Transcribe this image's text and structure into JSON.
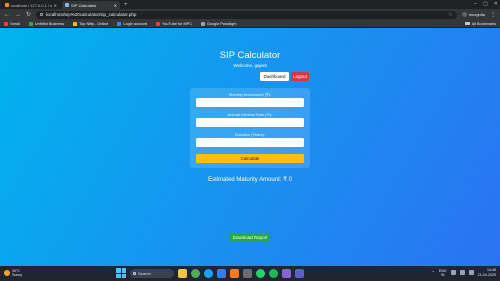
{
  "browser": {
    "tabs": [
      {
        "title": "localhost / 127.0.0.1 / sip_calcu",
        "favicon_color": "#f29900",
        "active": false
      },
      {
        "title": "SIP Calculator",
        "favicon_color": "#8ab4f8",
        "active": true
      }
    ],
    "address": "localhost/sip%20calculator/sip_calculator.php",
    "profile_label": "Incognito",
    "bookmarks": [
      {
        "label": "Gmail",
        "color": "#ea4335"
      },
      {
        "label": "Untitled Business",
        "color": "#34a853"
      },
      {
        "label": "Top Nifty - Online",
        "color": "#fbbc04"
      },
      {
        "label": "Login account",
        "color": "#4285f4"
      },
      {
        "label": "YouTube for MPC",
        "color": "#ea4335"
      },
      {
        "label": "Google Paradigm",
        "color": "#9aa0a6"
      }
    ],
    "all_bookmarks_label": "All Bookmarks"
  },
  "page": {
    "title": "SIP Calculator",
    "welcome": "Welcome, gajeet",
    "dashboard_label": "Dashboard",
    "logout_label": "Logout",
    "form": {
      "monthly_label": "Monthly Investment (₹):",
      "monthly_value": "",
      "rate_label": "Annual Interest Rate (%):",
      "rate_value": "",
      "duration_label": "Duration (Years):",
      "duration_value": "",
      "submit_label": "Calculate"
    },
    "result_text": "Estimated Maturity Amount: ₹ 0",
    "download_label": "Download Report"
  },
  "taskbar": {
    "weather_temp": "30°C",
    "weather_desc": "Sunny",
    "search_placeholder": "Search",
    "apps": [
      {
        "name": "file-explorer",
        "color": "#f6c443"
      },
      {
        "name": "chrome",
        "color": "#4caf50"
      },
      {
        "name": "edge",
        "color": "#1da1f2"
      },
      {
        "name": "vscode",
        "color": "#2f80ed"
      },
      {
        "name": "xampp",
        "color": "#fb7a24"
      },
      {
        "name": "terminal",
        "color": "#6c6c6c"
      },
      {
        "name": "whatsapp",
        "color": "#25d366"
      },
      {
        "name": "spotify",
        "color": "#1db954"
      },
      {
        "name": "store",
        "color": "#8a63d2"
      },
      {
        "name": "teams",
        "color": "#5b5fc7"
      }
    ],
    "lang_top": "ENG",
    "lang_bottom": "IN",
    "time": "14:48",
    "date": "21-04-2025"
  },
  "colors": {
    "page_gradient_start": "#00b4ee",
    "page_gradient_end": "#2b72f2",
    "calculate": "#ffc107",
    "logout": "#dc3545",
    "download": "#28a745"
  }
}
